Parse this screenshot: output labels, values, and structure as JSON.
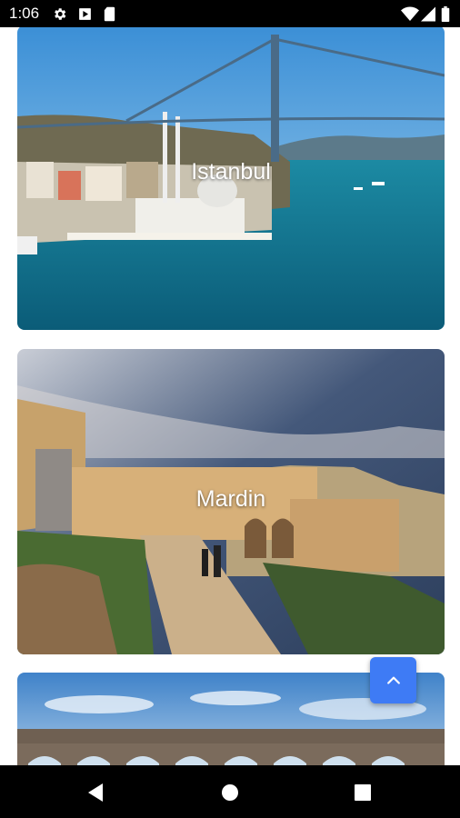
{
  "status_bar": {
    "time": "1:06",
    "left_icons": [
      "gear-icon",
      "play-store-icon",
      "sim-card-icon"
    ],
    "right_icons": [
      "wifi-icon",
      "signal-icon",
      "battery-icon"
    ]
  },
  "cities": [
    {
      "name": "Istanbul"
    },
    {
      "name": "Mardin"
    },
    {
      "name": ""
    }
  ],
  "fab": {
    "icon": "chevron-up-icon",
    "color": "#3e7bf5"
  },
  "nav_bar": {
    "icons": [
      "back-icon",
      "home-icon",
      "recents-icon"
    ]
  }
}
